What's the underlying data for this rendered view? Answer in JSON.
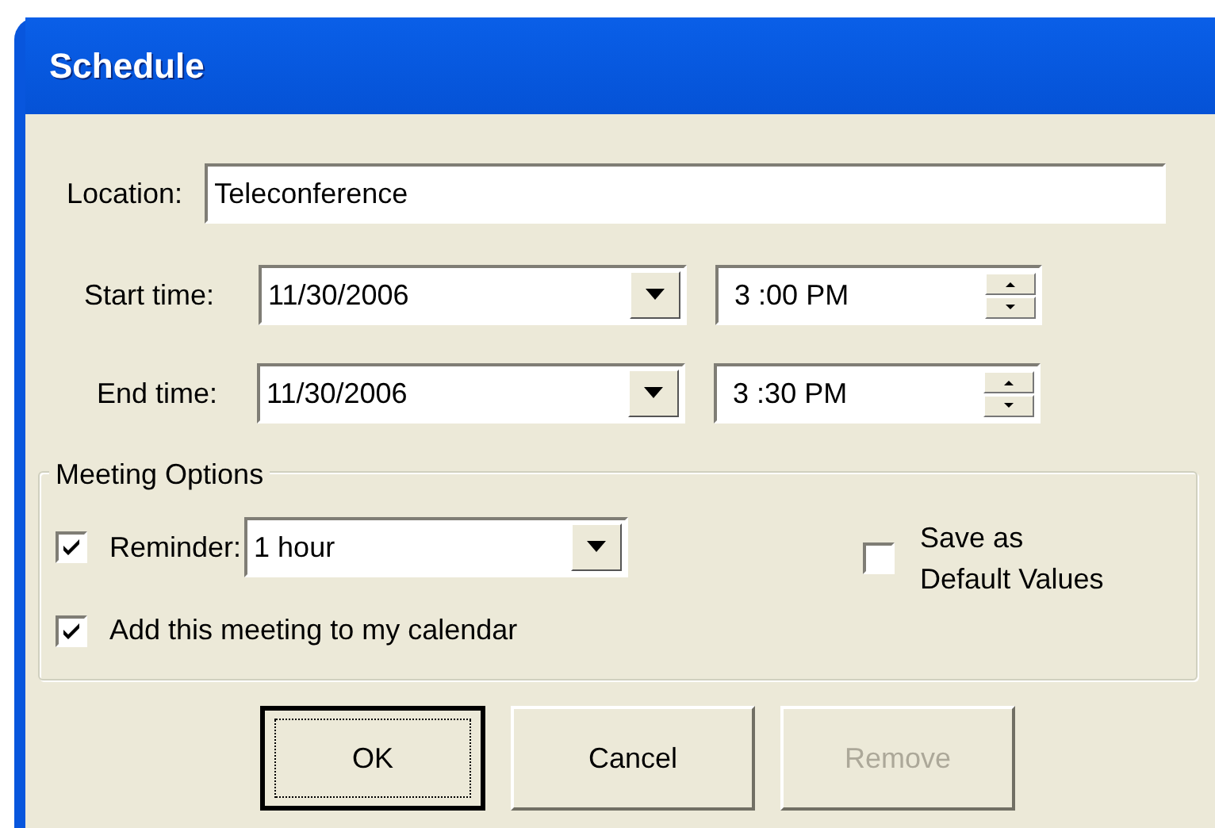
{
  "window": {
    "title": "Schedule"
  },
  "location": {
    "label": "Location:",
    "value": "Teleconference"
  },
  "start_time": {
    "label": "Start time:",
    "date": "11/30/2006",
    "time": "3 :00 PM"
  },
  "end_time": {
    "label": "End time:",
    "date": "11/30/2006",
    "time": "3 :30 PM"
  },
  "meeting_options": {
    "title": "Meeting Options",
    "reminder": {
      "label": "Reminder:",
      "checked": true,
      "value": "1 hour"
    },
    "save_defaults": {
      "label": "Save as\nDefault Values",
      "checked": false
    },
    "add_to_calendar": {
      "label": "Add this meeting to my calendar",
      "checked": true
    }
  },
  "buttons": [
    {
      "label": "OK",
      "default": true,
      "disabled": false
    },
    {
      "label": "Cancel",
      "default": false,
      "disabled": false
    },
    {
      "label": "Remove",
      "default": false,
      "disabled": true
    }
  ]
}
